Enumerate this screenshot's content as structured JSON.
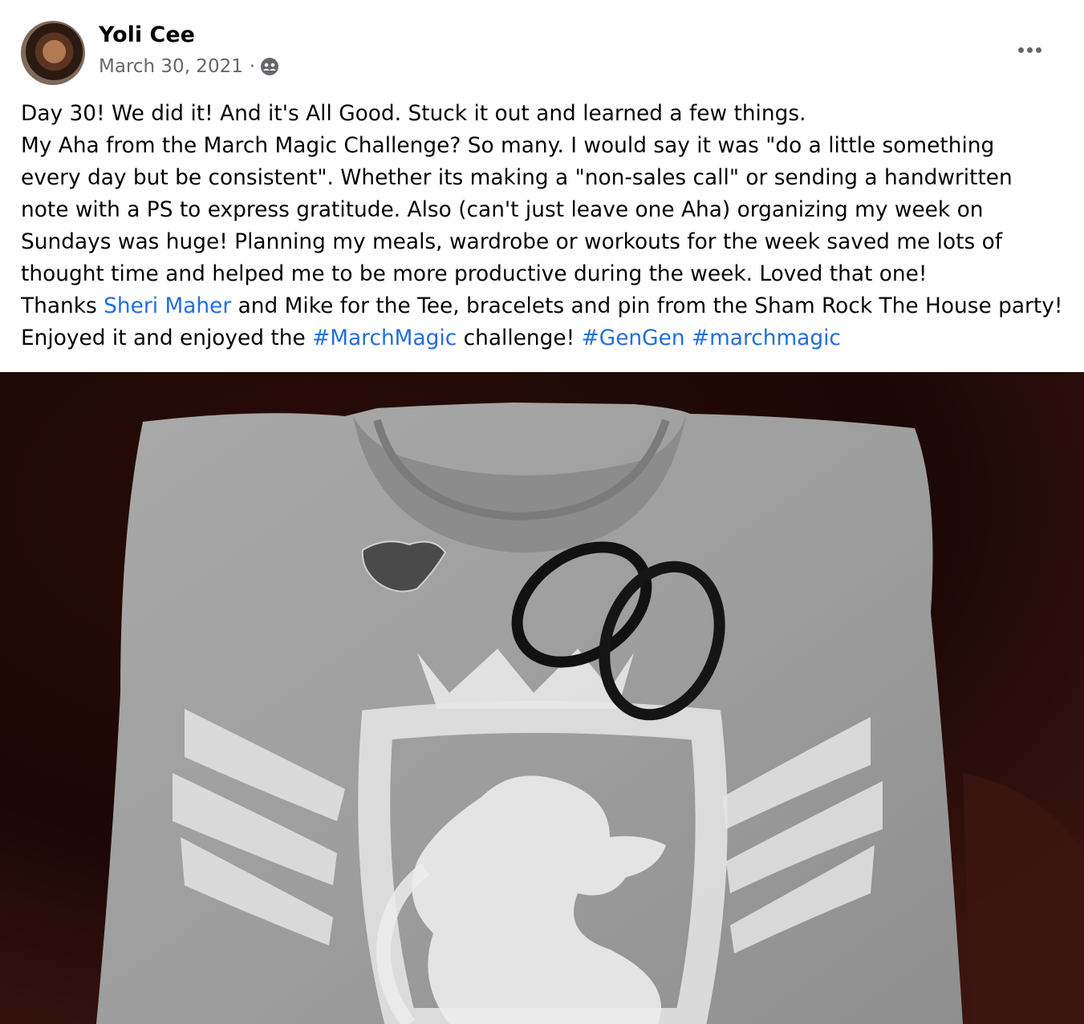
{
  "post": {
    "author": "Yoli Cee",
    "date": "March 30, 2021",
    "separator": "·",
    "audience_icon": "friends-audience-icon",
    "more_icon": "more-options-icon",
    "lines": {
      "l1": "Day 30! We did it! And it's All Good. Stuck it out and learned a few things.",
      "l2": "My Aha from the March Magic Challenge?  So many.  I would say it was \"do a little something",
      "l3": "every day but be consistent\".  Whether its making a \"non-sales call\" or sending a handwritten",
      "l4": "note with a PS to express gratitude.  Also (can't just leave one Aha) organizing my week on",
      "l5": "Sundays was huge! Planning my meals, wardrobe or workouts for the week saved me lots of",
      "l6": "thought time and helped me to be more productive during the week. Loved that one!",
      "l7_a": "Thanks ",
      "l7_link": "Sheri Maher",
      "l7_b": " and Mike for the Tee, bracelets and pin from the Sham Rock The House party!",
      "l8_a": "Enjoyed it and enjoyed the ",
      "l8_tag1": "#MarchMagic",
      "l8_b": " challenge! ",
      "l8_tag2": "#GenGen",
      "l8_sp": " ",
      "l8_tag3": "#marchmagic"
    }
  },
  "colors": {
    "link": "#216fdb",
    "meta": "#65676b",
    "text": "#050505"
  }
}
